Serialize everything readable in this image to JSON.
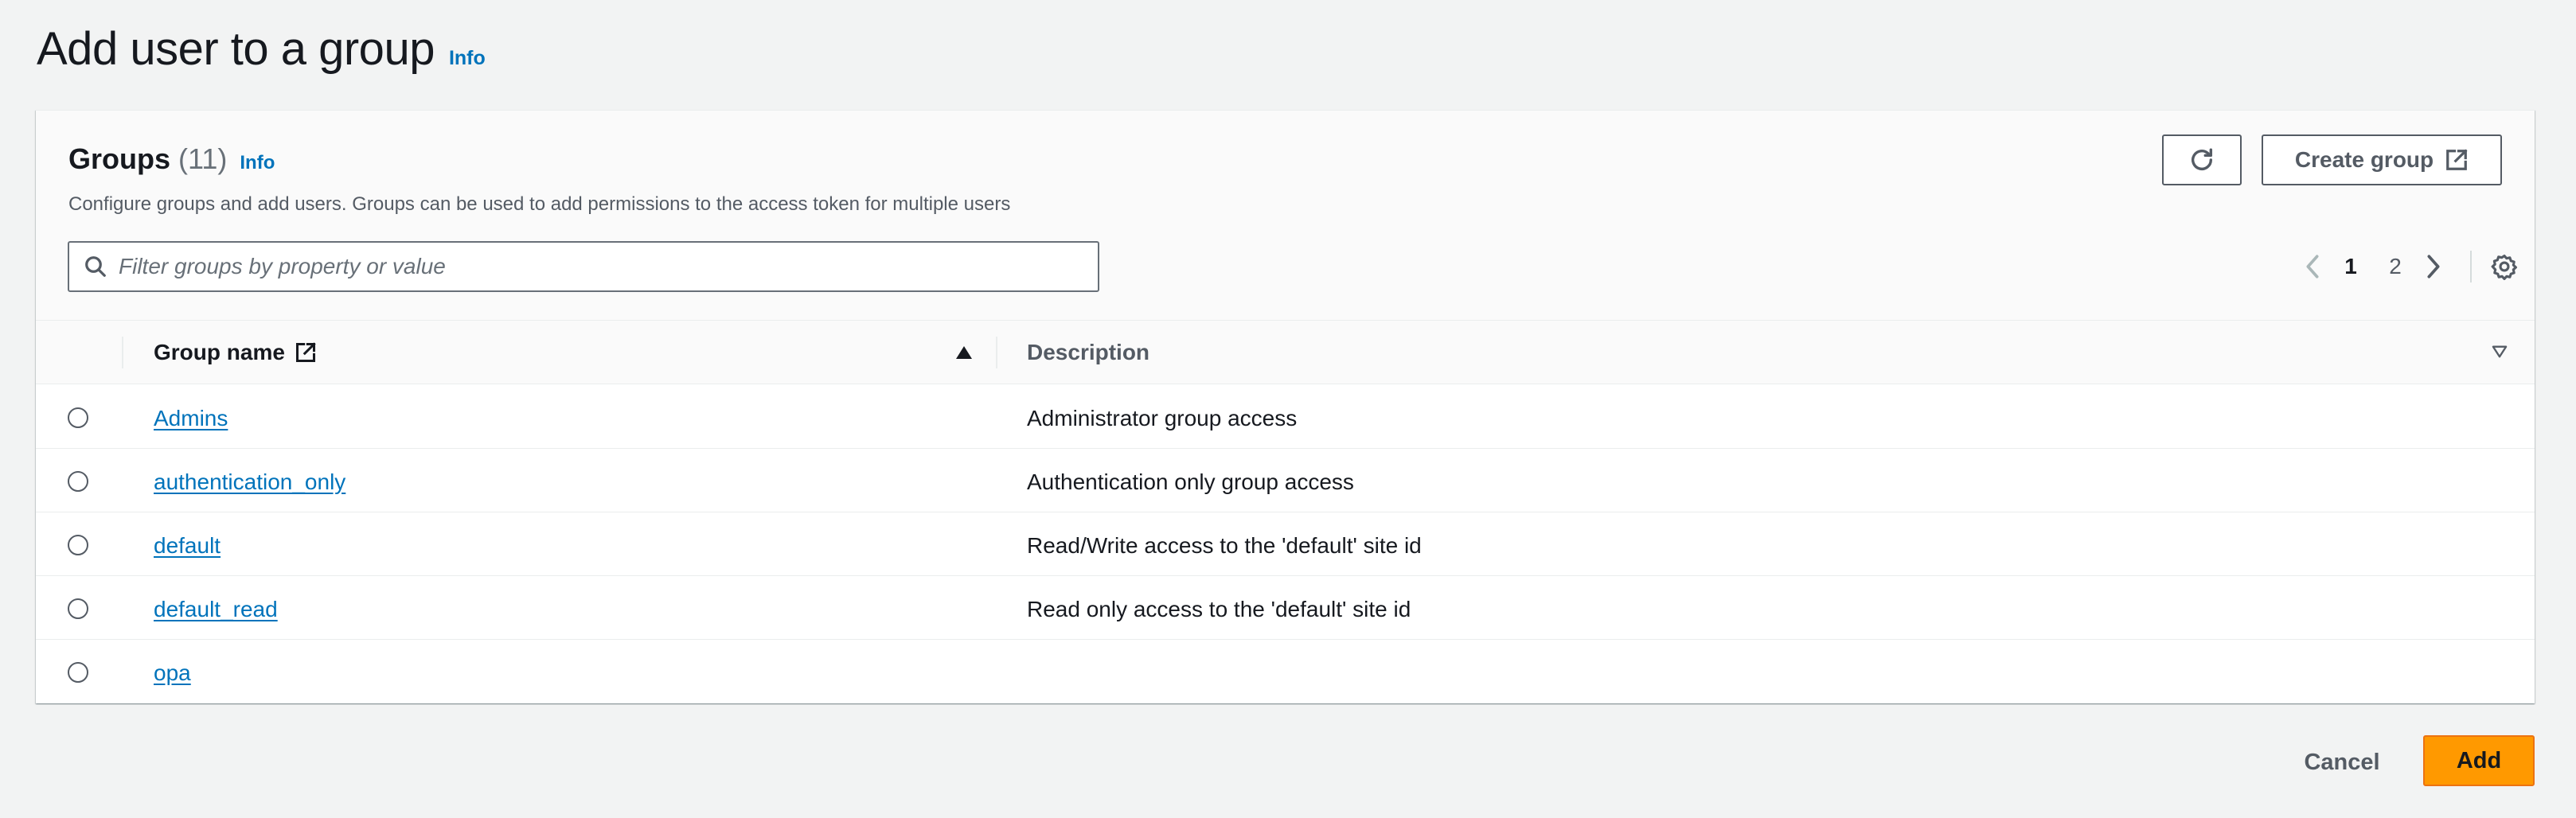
{
  "page": {
    "title": "Add user to a group",
    "info_label": "Info"
  },
  "groups": {
    "title": "Groups",
    "count": "(11)",
    "info_label": "Info",
    "description": "Configure groups and add users. Groups can be used to add permissions to the access token for multiple users",
    "create_label": "Create group",
    "search_placeholder": "Filter groups by property or value",
    "pagination": {
      "current": "1",
      "next_page": "2"
    },
    "columns": {
      "name": "Group name",
      "description": "Description"
    },
    "rows": [
      {
        "name": "Admins",
        "description": "Administrator group access"
      },
      {
        "name": "authentication_only",
        "description": "Authentication only group access"
      },
      {
        "name": "default",
        "description": "Read/Write access to the 'default' site id"
      },
      {
        "name": "default_read",
        "description": "Read only access to the 'default' site id"
      },
      {
        "name": "opa",
        "description": ""
      }
    ]
  },
  "footer": {
    "cancel_label": "Cancel",
    "add_label": "Add"
  },
  "colors": {
    "link": "#0073bb",
    "primary_button": "#ff9900",
    "background": "#f2f3f3"
  }
}
